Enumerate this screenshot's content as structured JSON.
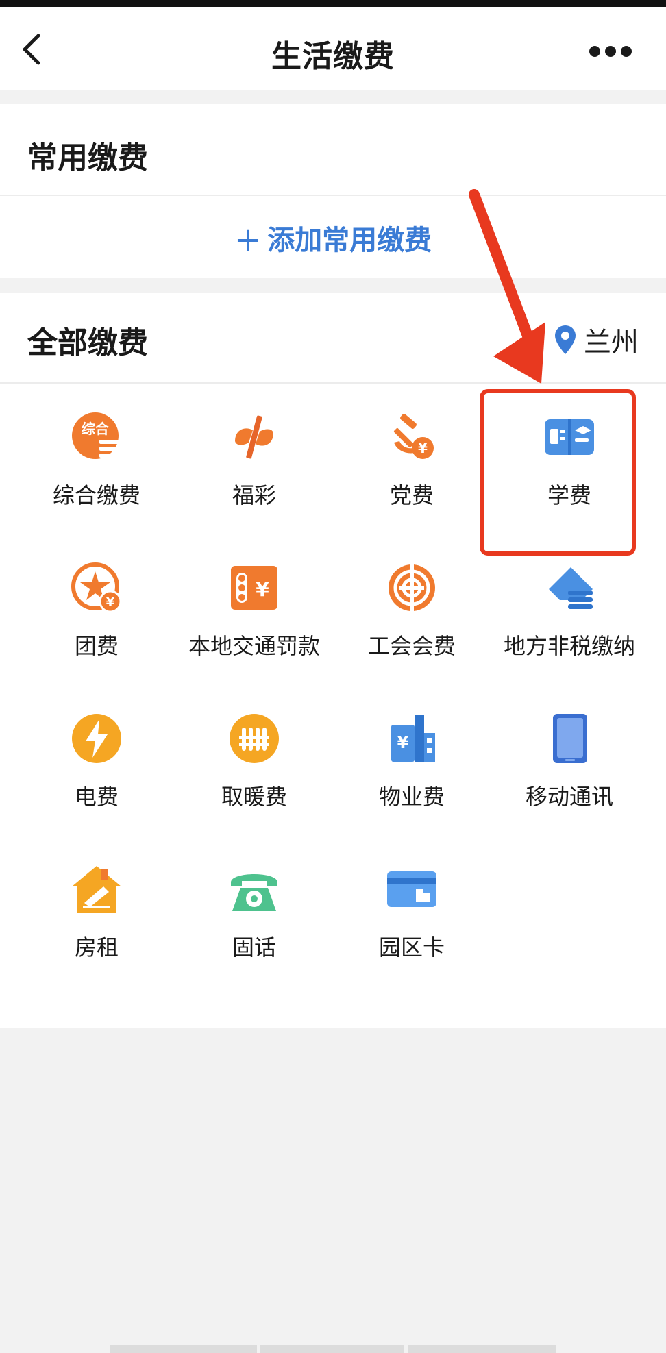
{
  "header": {
    "title": "生活缴费"
  },
  "common": {
    "title": "常用缴费",
    "add_label": "添加常用缴费"
  },
  "all": {
    "title": "全部缴费",
    "city": "兰州"
  },
  "items": [
    {
      "label": "综合缴费",
      "icon": "comprehensive-pay-icon"
    },
    {
      "label": "福彩",
      "icon": "welfare-lottery-icon"
    },
    {
      "label": "党费",
      "icon": "party-fee-icon"
    },
    {
      "label": "学费",
      "icon": "tuition-icon"
    },
    {
      "label": "团费",
      "icon": "league-fee-icon"
    },
    {
      "label": "本地交通罚款",
      "icon": "traffic-fine-icon"
    },
    {
      "label": "工会会费",
      "icon": "union-fee-icon"
    },
    {
      "label": "地方非税缴纳",
      "icon": "non-tax-payment-icon"
    },
    {
      "label": "电费",
      "icon": "electricity-icon"
    },
    {
      "label": "取暖费",
      "icon": "heating-icon"
    },
    {
      "label": "物业费",
      "icon": "property-fee-icon"
    },
    {
      "label": "移动通讯",
      "icon": "mobile-phone-icon"
    },
    {
      "label": "房租",
      "icon": "rent-icon"
    },
    {
      "label": "固话",
      "icon": "landline-icon"
    },
    {
      "label": "园区卡",
      "icon": "park-card-icon"
    }
  ],
  "colors": {
    "accent_blue": "#3a7bd5",
    "orange": "#f07a2e",
    "highlight_red": "#e8391f",
    "green": "#4ec28e"
  }
}
